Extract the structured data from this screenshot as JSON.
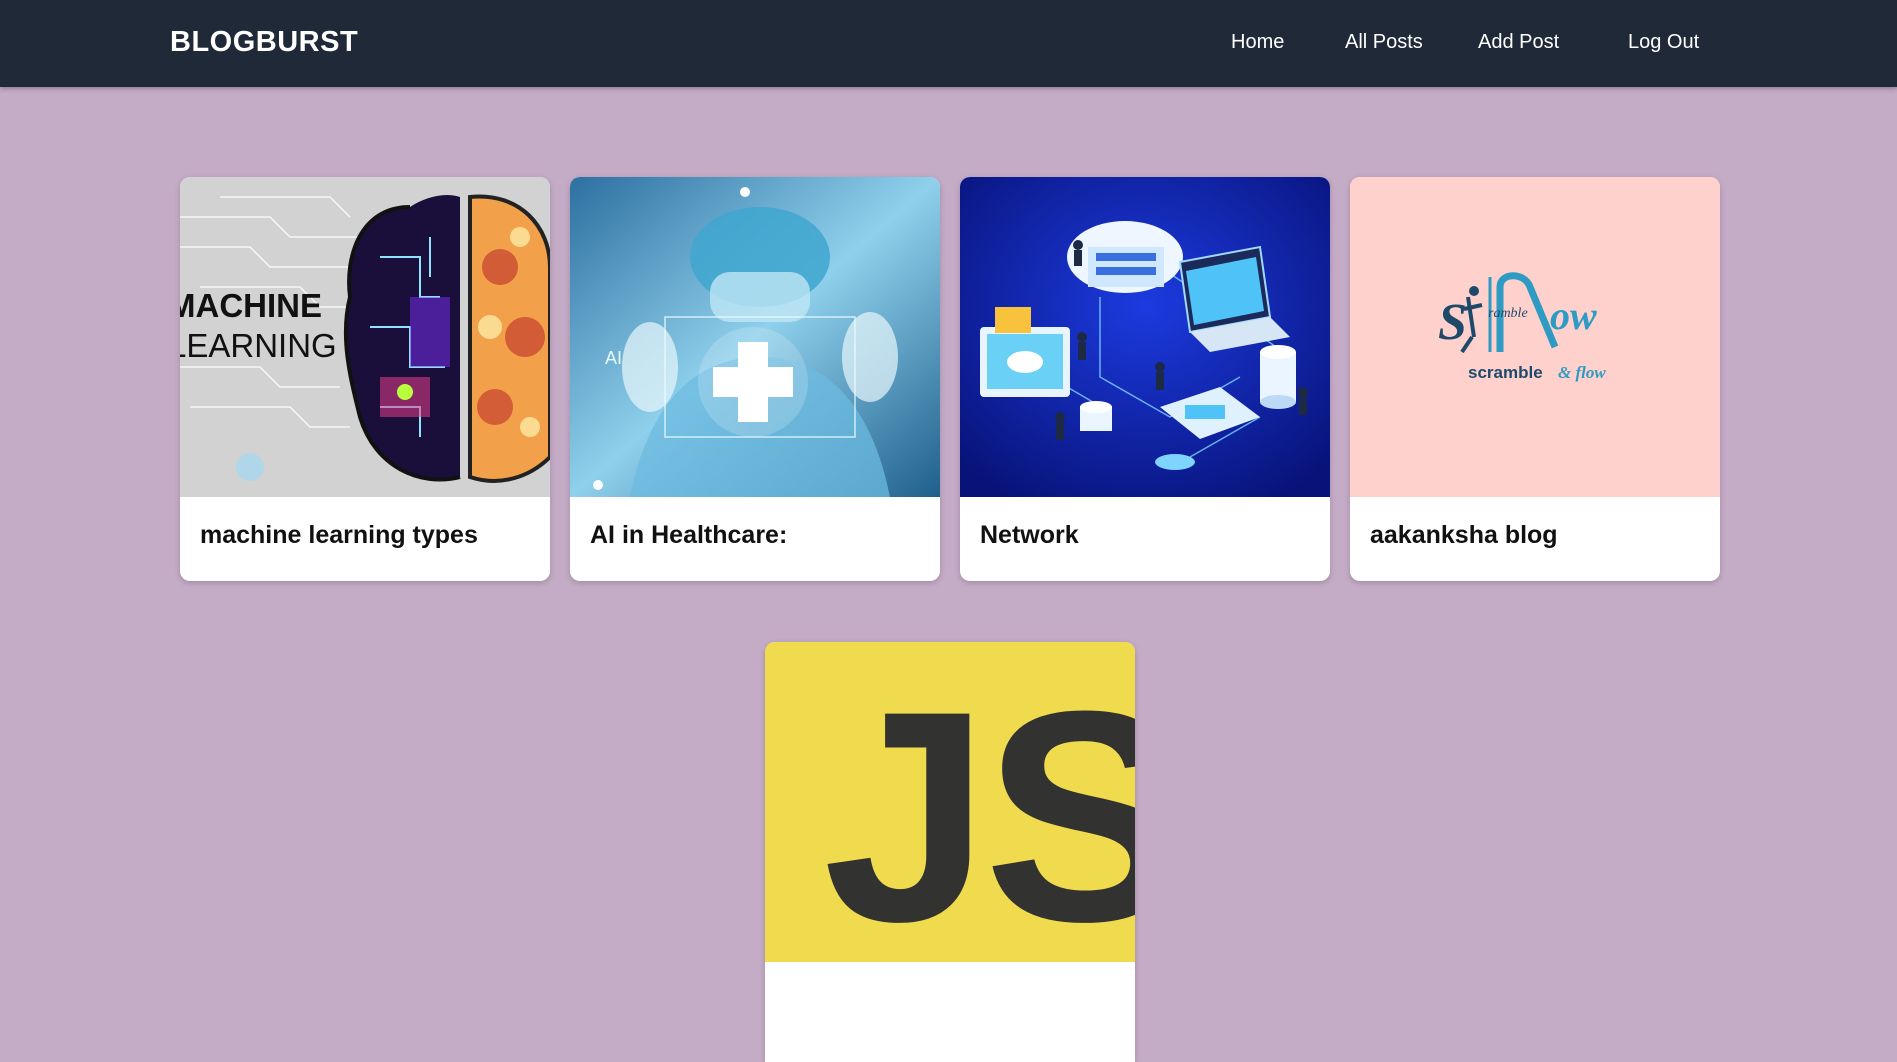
{
  "navbar": {
    "brand": "BLOGBURST",
    "links": [
      {
        "label": "Home"
      },
      {
        "label": "All Posts"
      },
      {
        "label": "Add Post"
      },
      {
        "label": "Log Out"
      }
    ]
  },
  "posts": [
    {
      "title": "machine learning types",
      "image_icon": "machine-learning-brain-image",
      "image_text": [
        "MACHINE",
        "LEARNING"
      ]
    },
    {
      "title": "AI in Healthcare:",
      "image_icon": "ai-healthcare-doctor-image",
      "image_text": [
        "AI"
      ]
    },
    {
      "title": "Network",
      "image_icon": "network-isometric-image"
    },
    {
      "title": "aakanksha blog",
      "image_icon": "scramble-flow-logo-image",
      "image_text": [
        "ramble",
        "ow",
        "scramble",
        "& flow"
      ]
    },
    {
      "title": "",
      "image_icon": "javascript-logo-image",
      "image_text": [
        "JS"
      ]
    }
  ],
  "colors": {
    "navbar_bg": "#1f2937",
    "page_bg": "#c4abc6",
    "card_bg": "#ffffff",
    "js_yellow": "#f0db4f",
    "scramble_bg": "#ffd1cc"
  }
}
